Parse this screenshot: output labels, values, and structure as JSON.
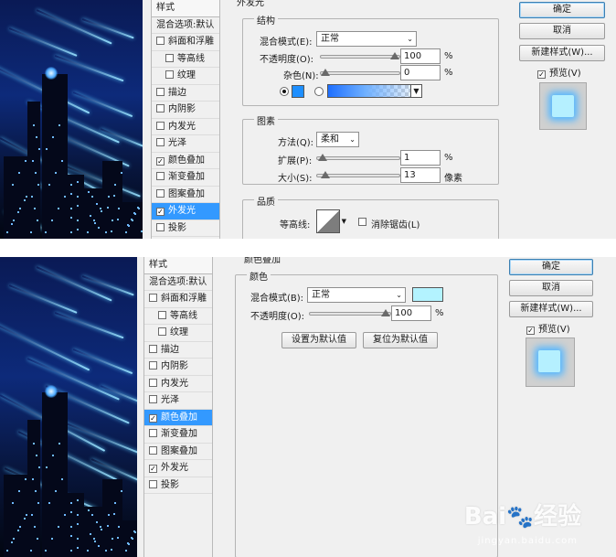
{
  "panel1": {
    "styles_header": "样式",
    "blend_options": "混合选项:默认",
    "styles": [
      {
        "label": "斜面和浮雕",
        "checked": false,
        "sub": false
      },
      {
        "label": "等高线",
        "checked": false,
        "sub": true
      },
      {
        "label": "纹理",
        "checked": false,
        "sub": true
      },
      {
        "label": "描边",
        "checked": false,
        "sub": false
      },
      {
        "label": "内阴影",
        "checked": false,
        "sub": false
      },
      {
        "label": "内发光",
        "checked": false,
        "sub": false
      },
      {
        "label": "光泽",
        "checked": false,
        "sub": false
      },
      {
        "label": "颜色叠加",
        "checked": true,
        "sub": false
      },
      {
        "label": "渐变叠加",
        "checked": false,
        "sub": false
      },
      {
        "label": "图案叠加",
        "checked": false,
        "sub": false
      },
      {
        "label": "外发光",
        "checked": true,
        "sub": false,
        "active": true
      },
      {
        "label": "投影",
        "checked": false,
        "sub": false
      }
    ],
    "section_title": "外发光",
    "structure": {
      "title": "结构",
      "blend_mode_label": "混合模式(E):",
      "blend_mode_value": "正常",
      "opacity_label": "不透明度(O):",
      "opacity_value": "100",
      "opacity_unit": "%",
      "opacity_fraction": 1.0,
      "noise_label": "杂色(N):",
      "noise_value": "0",
      "noise_unit": "%",
      "noise_fraction": 0.0,
      "glow_color": "#1e8fff"
    },
    "elements": {
      "title": "图素",
      "method_label": "方法(Q):",
      "method_value": "柔和",
      "spread_label": "扩展(P):",
      "spread_value": "1",
      "spread_unit": "%",
      "spread_fraction": 0.01,
      "size_label": "大小(S):",
      "size_value": "13",
      "size_unit": "像素",
      "size_fraction": 0.05
    },
    "quality": {
      "title": "品质",
      "contour_label": "等高线:",
      "antialias_label": "消除锯齿(L)"
    },
    "buttons": {
      "ok": "确定",
      "cancel": "取消",
      "new_style": "新建样式(W)...",
      "preview": "预览(V)"
    }
  },
  "panel2": {
    "styles_header": "样式",
    "blend_options": "混合选项:默认",
    "styles": [
      {
        "label": "斜面和浮雕",
        "checked": false,
        "sub": false
      },
      {
        "label": "等高线",
        "checked": false,
        "sub": true
      },
      {
        "label": "纹理",
        "checked": false,
        "sub": true
      },
      {
        "label": "描边",
        "checked": false,
        "sub": false
      },
      {
        "label": "内阴影",
        "checked": false,
        "sub": false
      },
      {
        "label": "内发光",
        "checked": false,
        "sub": false
      },
      {
        "label": "光泽",
        "checked": false,
        "sub": false
      },
      {
        "label": "颜色叠加",
        "checked": true,
        "sub": false,
        "active": true
      },
      {
        "label": "渐变叠加",
        "checked": false,
        "sub": false
      },
      {
        "label": "图案叠加",
        "checked": false,
        "sub": false
      },
      {
        "label": "外发光",
        "checked": true,
        "sub": false
      },
      {
        "label": "投影",
        "checked": false,
        "sub": false
      }
    ],
    "section_title": "颜色叠加",
    "color": {
      "title": "颜色",
      "blend_mode_label": "混合模式(B):",
      "blend_mode_value": "正常",
      "overlay_color": "#b3f3ff",
      "opacity_label": "不透明度(O):",
      "opacity_value": "100",
      "opacity_unit": "%",
      "opacity_fraction": 1.0
    },
    "set_default": "设置为默认值",
    "reset_default": "复位为默认值",
    "buttons": {
      "ok": "确定",
      "cancel": "取消",
      "new_style": "新建样式(W)...",
      "preview": "预览(V)"
    }
  },
  "watermark": {
    "brand_left": "Bai",
    "brand_right": "经验",
    "url": "jingyan.baidu.com"
  },
  "colors": {
    "selection": "#3399ff",
    "glow_swatch": "#1e8fff",
    "overlay_swatch": "#b3f3ff"
  }
}
